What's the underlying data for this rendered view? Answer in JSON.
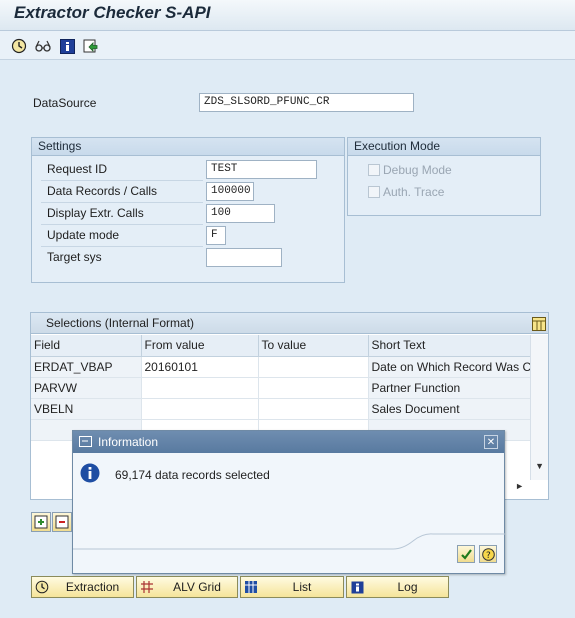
{
  "window": {
    "title": "Extractor Checker S-API"
  },
  "toolbar": {
    "icons": [
      "execute-icon",
      "glasses-icon",
      "info-icon",
      "refresh-icon"
    ]
  },
  "datasource": {
    "label": "DataSource",
    "value": "ZDS_SLSORD_PFUNC_CR"
  },
  "settings": {
    "title": "Settings",
    "fields": [
      {
        "label": "Request ID",
        "value": "TEST"
      },
      {
        "label": "Data Records / Calls",
        "value": "100000"
      },
      {
        "label": "Display Extr. Calls",
        "value": "100"
      },
      {
        "label": "Update mode",
        "value": "F"
      },
      {
        "label": "Target sys",
        "value": ""
      }
    ]
  },
  "execution_mode": {
    "title": "Execution Mode",
    "options": [
      {
        "label": "Debug Mode",
        "checked": false
      },
      {
        "label": "Auth. Trace",
        "checked": false
      }
    ]
  },
  "selections": {
    "title": "Selections (Internal Format)",
    "columns": [
      "Field",
      "From value",
      "To value",
      "Short Text"
    ],
    "rows": [
      {
        "field": "ERDAT_VBAP",
        "from": "20160101",
        "to": "",
        "text": "Date on Which Record Was C"
      },
      {
        "field": "PARVW",
        "from": "",
        "to": "",
        "text": "Partner Function"
      },
      {
        "field": "VBELN",
        "from": "",
        "to": "",
        "text": "Sales Document"
      }
    ]
  },
  "dialog": {
    "title": "Information",
    "message": "69,174 data records selected"
  },
  "buttons": {
    "extraction": "Extraction",
    "alv_grid": "ALV Grid",
    "list": "List",
    "log": "Log"
  },
  "colors": {
    "accent": "#587aa0",
    "button": "#f5e49a",
    "info": "#1f4ea3"
  }
}
